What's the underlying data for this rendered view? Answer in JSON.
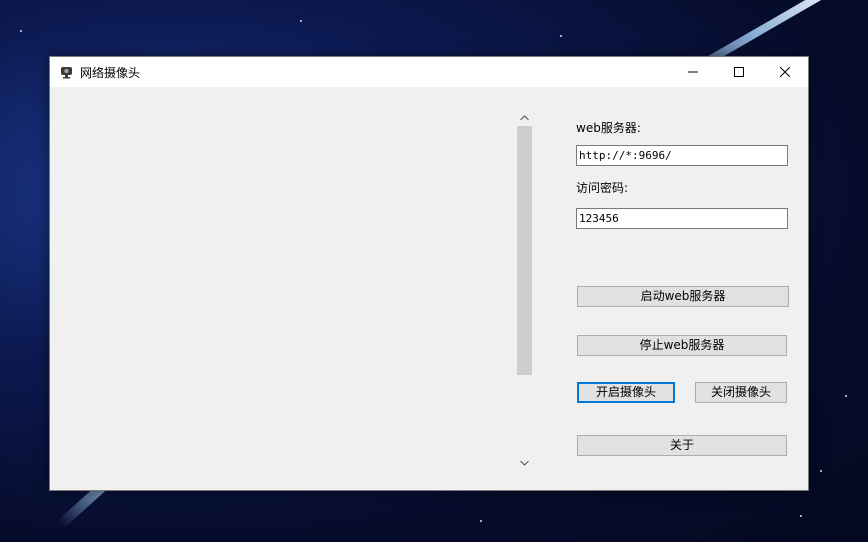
{
  "window": {
    "title": "网络摄像头",
    "app_icon": "camera-icon",
    "controls": [
      "minimize-icon",
      "maximize-icon",
      "close-icon"
    ]
  },
  "server": {
    "label": "web服务器:",
    "url_value": "http://*:9696/"
  },
  "password": {
    "label": "访问密码:",
    "value": "123456"
  },
  "buttons": {
    "start_server": "启动web服务器",
    "stop_server": "停止web服务器",
    "open_camera": "开启摄像头",
    "close_camera": "关闭摄像头",
    "about": "关于"
  },
  "colors": {
    "focus_accent": "#0078d7",
    "window_background": "#f0f0f0"
  }
}
